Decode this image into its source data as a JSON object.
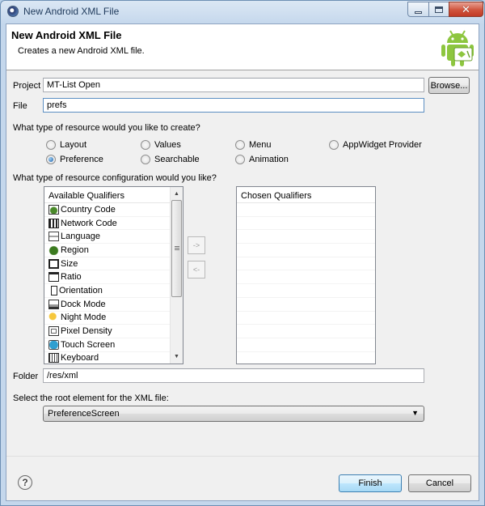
{
  "window": {
    "title": "New Android XML File"
  },
  "banner": {
    "title": "New Android XML File",
    "description": "Creates a new Android XML file.",
    "logo_icon": "android-logo-icon"
  },
  "form": {
    "project_label": "Project",
    "project_value": "MT-List Open",
    "browse_label": "Browse...",
    "file_label": "File",
    "file_value": "prefs",
    "resource_type_question": "What type of resource would you like to create?",
    "resource_types": [
      {
        "label": "Layout",
        "checked": false
      },
      {
        "label": "Values",
        "checked": false
      },
      {
        "label": "Menu",
        "checked": false
      },
      {
        "label": "AppWidget Provider",
        "checked": false
      },
      {
        "label": "Preference",
        "checked": true
      },
      {
        "label": "Searchable",
        "checked": false
      },
      {
        "label": "Animation",
        "checked": false
      }
    ],
    "config_question": "What type of resource configuration would you like?",
    "available_header": "Available Qualifiers",
    "available_qualifiers": [
      "Country Code",
      "Network Code",
      "Language",
      "Region",
      "Size",
      "Ratio",
      "Orientation",
      "Dock Mode",
      "Night Mode",
      "Pixel Density",
      "Touch Screen",
      "Keyboard"
    ],
    "add_button": "->",
    "remove_button": "<-",
    "chosen_header": "Chosen Qualifiers",
    "folder_label": "Folder",
    "folder_value": "/res/xml",
    "root_element_label": "Select the root element for the XML file:",
    "root_element_value": "PreferenceScreen"
  },
  "footer": {
    "help_glyph": "?",
    "finish_label": "Finish",
    "cancel_label": "Cancel"
  }
}
